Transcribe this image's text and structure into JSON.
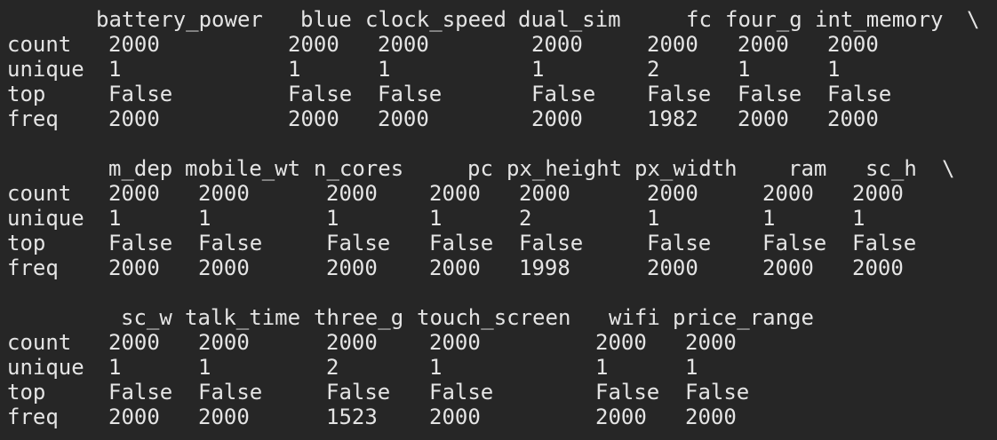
{
  "output": {
    "blocks": [
      {
        "columns": [
          "battery_power",
          "blue",
          "clock_speed",
          "dual_sim",
          "fc",
          "four_g",
          "int_memory"
        ],
        "continuation": "\\",
        "rows": [
          {
            "label": "count",
            "values": [
              "2000",
              "2000",
              "2000",
              "2000",
              "2000",
              "2000",
              "2000"
            ]
          },
          {
            "label": "unique",
            "values": [
              "1",
              "1",
              "1",
              "1",
              "2",
              "1",
              "1"
            ]
          },
          {
            "label": "top",
            "values": [
              "False",
              "False",
              "False",
              "False",
              "False",
              "False",
              "False"
            ]
          },
          {
            "label": "freq",
            "values": [
              "2000",
              "2000",
              "2000",
              "2000",
              "1982",
              "2000",
              "2000"
            ]
          }
        ]
      },
      {
        "columns": [
          "m_dep",
          "mobile_wt",
          "n_cores",
          "pc",
          "px_height",
          "px_width",
          "ram",
          "sc_h"
        ],
        "continuation": "\\",
        "rows": [
          {
            "label": "count",
            "values": [
              "2000",
              "2000",
              "2000",
              "2000",
              "2000",
              "2000",
              "2000",
              "2000"
            ]
          },
          {
            "label": "unique",
            "values": [
              "1",
              "1",
              "1",
              "1",
              "2",
              "1",
              "1",
              "1"
            ]
          },
          {
            "label": "top",
            "values": [
              "False",
              "False",
              "False",
              "False",
              "False",
              "False",
              "False",
              "False"
            ]
          },
          {
            "label": "freq",
            "values": [
              "2000",
              "2000",
              "2000",
              "2000",
              "1998",
              "2000",
              "2000",
              "2000"
            ]
          }
        ]
      },
      {
        "columns": [
          "sc_w",
          "talk_time",
          "three_g",
          "touch_screen",
          "wifi",
          "price_range"
        ],
        "continuation": "",
        "rows": [
          {
            "label": "count",
            "values": [
              "2000",
              "2000",
              "2000",
              "2000",
              "2000",
              "2000"
            ]
          },
          {
            "label": "unique",
            "values": [
              "1",
              "1",
              "2",
              "1",
              "1",
              "1"
            ]
          },
          {
            "label": "top",
            "values": [
              "False",
              "False",
              "False",
              "False",
              "False",
              "False"
            ]
          },
          {
            "label": "freq",
            "values": [
              "2000",
              "2000",
              "1523",
              "2000",
              "2000",
              "2000"
            ]
          }
        ]
      }
    ]
  }
}
